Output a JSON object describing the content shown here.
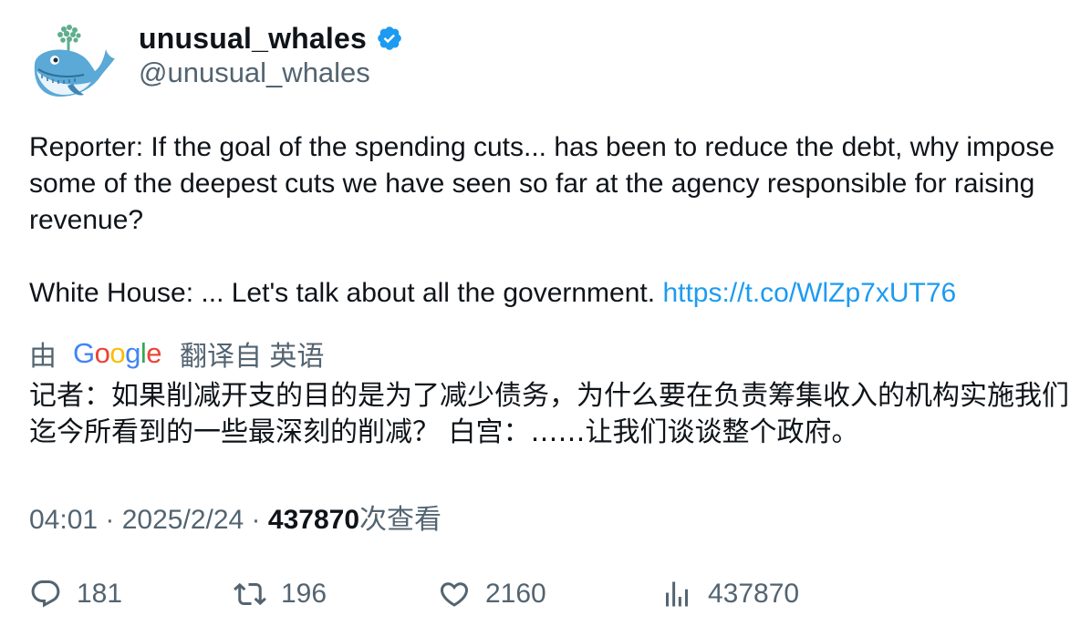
{
  "user": {
    "display_name": "unusual_whales",
    "handle": "@unusual_whales",
    "verified": true,
    "avatar_icon": "whale-icon"
  },
  "tweet": {
    "paragraph1": "Reporter: If the goal of the spending cuts... has been to reduce the debt, why impose some of the deepest cuts we have seen so far at the agency responsible for raising revenue?",
    "paragraph2": "White House: ... Let's talk about all the government. ",
    "link": "https://t.co/WlZp7xUT76"
  },
  "translation": {
    "by": "由",
    "provider": "Google",
    "label": "翻译自 英语",
    "text": "记者：如果削减开支的目的是为了减少债务，为什么要在负责筹集收入的机构实施我们迄今所看到的一些最深刻的削减？ 白宫：……让我们谈谈整个政府。"
  },
  "meta": {
    "time": "04:01",
    "sep1": " · ",
    "date": "2025/2/24",
    "sep2": " · ",
    "views": "437870",
    "views_suffix": "次查看"
  },
  "actions": {
    "replies": "181",
    "retweets": "196",
    "likes": "2160",
    "views": "437870"
  },
  "colors": {
    "link": "#1d9bf0",
    "verified": "#1d9bf0",
    "secondary_text": "#536471",
    "primary_text": "#0f1419"
  }
}
